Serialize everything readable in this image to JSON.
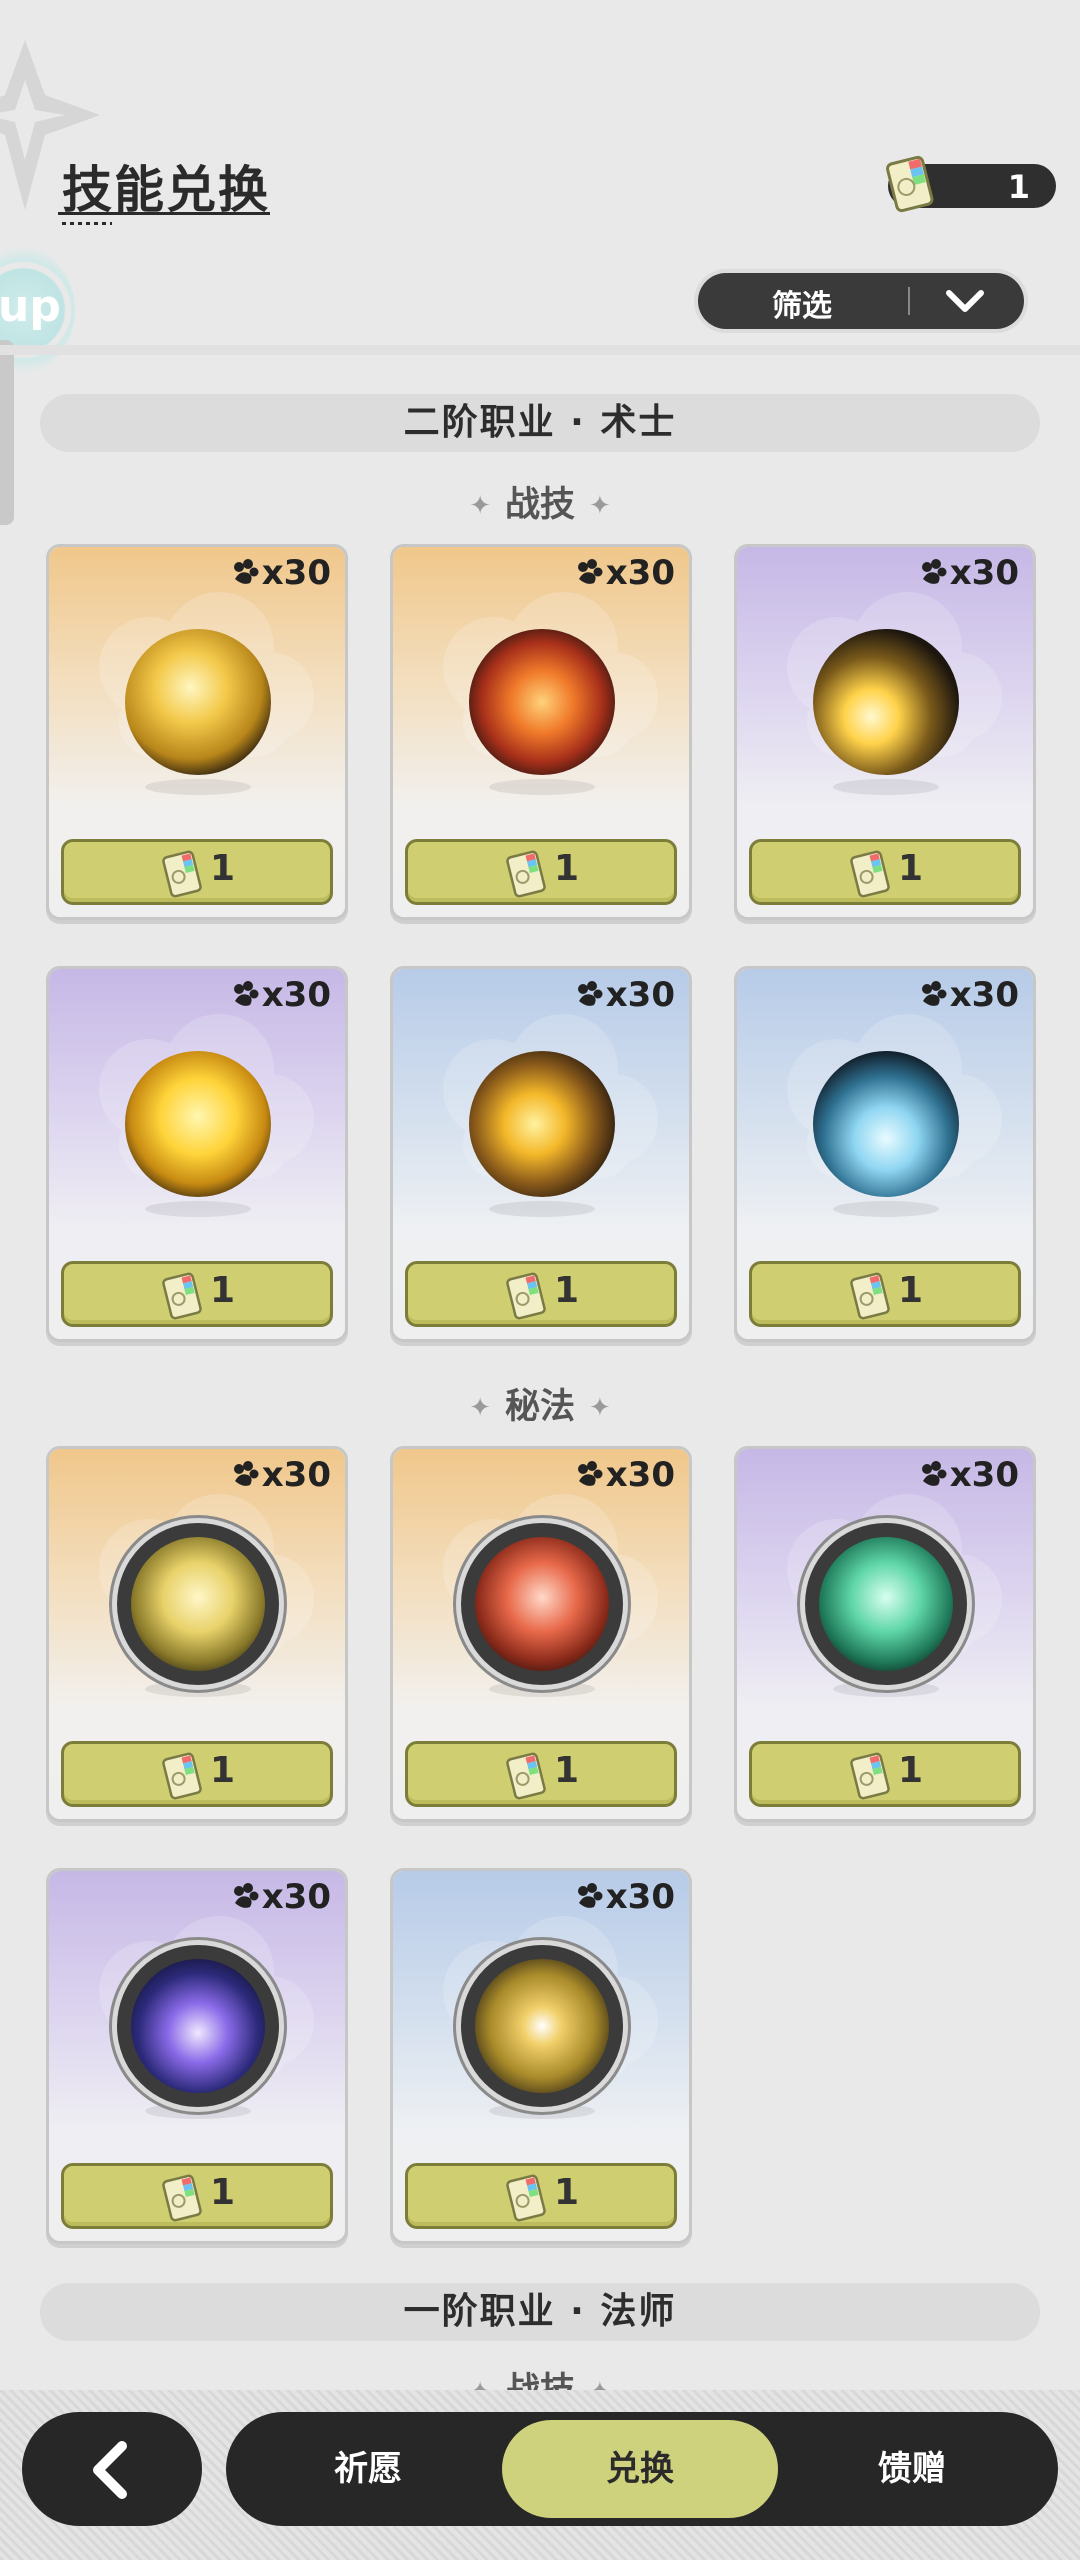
{
  "header": {
    "title": "技能兑换",
    "currency_value": "1",
    "currency_icon": "ticket-icon",
    "filter_label": "筛选"
  },
  "sections": [
    {
      "title": "二阶职业 · 术士",
      "groups": [
        {
          "name": "战技",
          "cards": [
            {
              "cost": "x30",
              "price": "1",
              "theme": "gold",
              "icon": "golden-star-burst-skill-icon"
            },
            {
              "cost": "x30",
              "price": "1",
              "theme": "gold",
              "icon": "fire-swirl-skill-icon"
            },
            {
              "cost": "x30",
              "price": "1",
              "theme": "purple",
              "icon": "lightning-strike-skill-icon"
            },
            {
              "cost": "x30",
              "price": "1",
              "theme": "purple",
              "icon": "golden-figure-skill-icon"
            },
            {
              "cost": "x30",
              "price": "1",
              "theme": "blue",
              "icon": "golden-slash-skill-icon"
            },
            {
              "cost": "x30",
              "price": "1",
              "theme": "blue",
              "icon": "ice-crystal-skill-icon"
            }
          ]
        },
        {
          "name": "秘法",
          "cards": [
            {
              "cost": "x30",
              "price": "1",
              "theme": "gold",
              "icon": "golden-figure-rune-icon"
            },
            {
              "cost": "x30",
              "price": "1",
              "theme": "gold",
              "icon": "red-flame-rune-icon"
            },
            {
              "cost": "x30",
              "price": "1",
              "theme": "purple",
              "icon": "green-chain-rune-icon"
            },
            {
              "cost": "x30",
              "price": "1",
              "theme": "purple",
              "icon": "starry-night-rune-icon"
            },
            {
              "cost": "x30",
              "price": "1",
              "theme": "blue",
              "icon": "golden-shatter-rune-icon"
            }
          ]
        }
      ]
    },
    {
      "title": "一阶职业 · 法师",
      "groups": [
        {
          "name": "战技",
          "cards": []
        }
      ]
    }
  ],
  "nav": {
    "back_icon": "chevron-left-icon",
    "tabs": [
      "祈愿",
      "兑换",
      "馈赠"
    ],
    "active_tab": "兑换"
  },
  "colors": {
    "accent": "#cfd27c",
    "button": "#cfcf72",
    "dark": "#272727"
  }
}
